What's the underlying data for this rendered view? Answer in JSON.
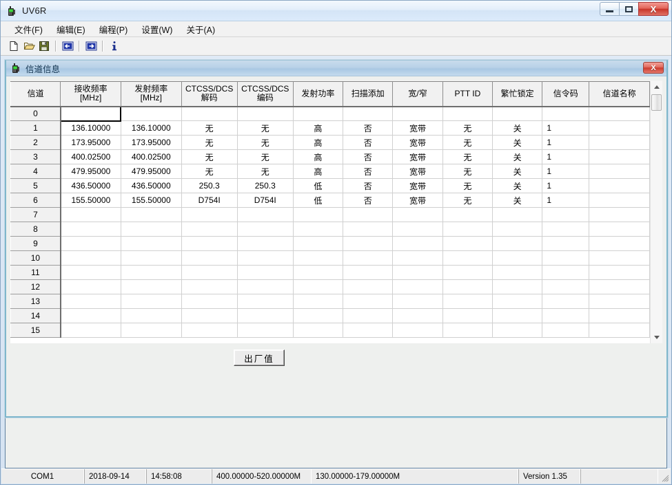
{
  "window": {
    "title": "UV6R",
    "icon": "radio-icon",
    "controls": {
      "minimize": "minimize-icon",
      "maximize": "maximize-icon",
      "close": "X"
    }
  },
  "menubar": {
    "items": [
      {
        "label": "文件(F)",
        "name": "menu-file"
      },
      {
        "label": "编辑(E)",
        "name": "menu-edit"
      },
      {
        "label": "编程(P)",
        "name": "menu-program"
      },
      {
        "label": "设置(W)",
        "name": "menu-settings"
      },
      {
        "label": "关于(A)",
        "name": "menu-about"
      }
    ]
  },
  "toolbar": {
    "buttons": [
      {
        "name": "new-file-icon",
        "title": "新建"
      },
      {
        "name": "open-folder-icon",
        "title": "打开"
      },
      {
        "name": "save-disk-icon",
        "title": "保存"
      },
      {
        "name": "read-from-radio-icon",
        "title": "读取"
      },
      {
        "name": "write-to-radio-icon",
        "title": "写入"
      },
      {
        "name": "info-icon",
        "title": "信息"
      }
    ]
  },
  "child_window": {
    "title": "信道信息",
    "icon": "radio-icon",
    "close_label": "X"
  },
  "grid": {
    "columns": [
      {
        "label": "信道",
        "name": "col-channel"
      },
      {
        "label": "接收频率\n[MHz]",
        "name": "col-rx-freq"
      },
      {
        "label": "发射频率\n[MHz]",
        "name": "col-tx-freq"
      },
      {
        "label": "CTCSS/DCS\n解码",
        "name": "col-ctcss-decode"
      },
      {
        "label": "CTCSS/DCS\n编码",
        "name": "col-ctcss-encode"
      },
      {
        "label": "发射功率",
        "name": "col-tx-power"
      },
      {
        "label": "扫描添加",
        "name": "col-scan-add"
      },
      {
        "label": "宽/窄",
        "name": "col-bandwidth"
      },
      {
        "label": "PTT ID",
        "name": "col-ptt-id"
      },
      {
        "label": "繁忙锁定",
        "name": "col-busy-lock"
      },
      {
        "label": "信令码",
        "name": "col-signal-code"
      },
      {
        "label": "信道名称",
        "name": "col-channel-name"
      }
    ],
    "rows": [
      {
        "channel": "0",
        "rx": "",
        "tx": "",
        "decode": "",
        "encode": "",
        "power": "",
        "scan": "",
        "band": "",
        "ptt": "",
        "busy": "",
        "sigcode": "",
        "name": "",
        "focused_cell": 1
      },
      {
        "channel": "1",
        "rx": "136.10000",
        "tx": "136.10000",
        "decode": "无",
        "encode": "无",
        "power": "高",
        "scan": "否",
        "band": "宽带",
        "ptt": "无",
        "busy": "关",
        "sigcode": "1",
        "name": ""
      },
      {
        "channel": "2",
        "rx": "173.95000",
        "tx": "173.95000",
        "decode": "无",
        "encode": "无",
        "power": "高",
        "scan": "否",
        "band": "宽带",
        "ptt": "无",
        "busy": "关",
        "sigcode": "1",
        "name": ""
      },
      {
        "channel": "3",
        "rx": "400.02500",
        "tx": "400.02500",
        "decode": "无",
        "encode": "无",
        "power": "高",
        "scan": "否",
        "band": "宽带",
        "ptt": "无",
        "busy": "关",
        "sigcode": "1",
        "name": ""
      },
      {
        "channel": "4",
        "rx": "479.95000",
        "tx": "479.95000",
        "decode": "无",
        "encode": "无",
        "power": "高",
        "scan": "否",
        "band": "宽带",
        "ptt": "无",
        "busy": "关",
        "sigcode": "1",
        "name": ""
      },
      {
        "channel": "5",
        "rx": "436.50000",
        "tx": "436.50000",
        "decode": "250.3",
        "encode": "250.3",
        "power": "低",
        "scan": "否",
        "band": "宽带",
        "ptt": "无",
        "busy": "关",
        "sigcode": "1",
        "name": ""
      },
      {
        "channel": "6",
        "rx": "155.50000",
        "tx": "155.50000",
        "decode": "D754I",
        "encode": "D754I",
        "power": "低",
        "scan": "否",
        "band": "宽带",
        "ptt": "无",
        "busy": "关",
        "sigcode": "1",
        "name": ""
      },
      {
        "channel": "7",
        "rx": "",
        "tx": "",
        "decode": "",
        "encode": "",
        "power": "",
        "scan": "",
        "band": "",
        "ptt": "",
        "busy": "",
        "sigcode": "",
        "name": ""
      },
      {
        "channel": "8",
        "rx": "",
        "tx": "",
        "decode": "",
        "encode": "",
        "power": "",
        "scan": "",
        "band": "",
        "ptt": "",
        "busy": "",
        "sigcode": "",
        "name": ""
      },
      {
        "channel": "9",
        "rx": "",
        "tx": "",
        "decode": "",
        "encode": "",
        "power": "",
        "scan": "",
        "band": "",
        "ptt": "",
        "busy": "",
        "sigcode": "",
        "name": ""
      },
      {
        "channel": "10",
        "rx": "",
        "tx": "",
        "decode": "",
        "encode": "",
        "power": "",
        "scan": "",
        "band": "",
        "ptt": "",
        "busy": "",
        "sigcode": "",
        "name": ""
      },
      {
        "channel": "11",
        "rx": "",
        "tx": "",
        "decode": "",
        "encode": "",
        "power": "",
        "scan": "",
        "band": "",
        "ptt": "",
        "busy": "",
        "sigcode": "",
        "name": ""
      },
      {
        "channel": "12",
        "rx": "",
        "tx": "",
        "decode": "",
        "encode": "",
        "power": "",
        "scan": "",
        "band": "",
        "ptt": "",
        "busy": "",
        "sigcode": "",
        "name": ""
      },
      {
        "channel": "13",
        "rx": "",
        "tx": "",
        "decode": "",
        "encode": "",
        "power": "",
        "scan": "",
        "band": "",
        "ptt": "",
        "busy": "",
        "sigcode": "",
        "name": ""
      },
      {
        "channel": "14",
        "rx": "",
        "tx": "",
        "decode": "",
        "encode": "",
        "power": "",
        "scan": "",
        "band": "",
        "ptt": "",
        "busy": "",
        "sigcode": "",
        "name": ""
      },
      {
        "channel": "15",
        "rx": "",
        "tx": "",
        "decode": "",
        "encode": "",
        "power": "",
        "scan": "",
        "band": "",
        "ptt": "",
        "busy": "",
        "sigcode": "",
        "name": ""
      }
    ]
  },
  "actions": {
    "factory_default_label": "出厂值"
  },
  "statusbar": {
    "panes": [
      {
        "text": "COM1",
        "name": "status-com-port"
      },
      {
        "text": "2018-09-14",
        "name": "status-date"
      },
      {
        "text": "14:58:08",
        "name": "status-time"
      },
      {
        "text": "400.00000-520.00000M",
        "name": "status-uhf-range"
      },
      {
        "text": "130.00000-179.00000M",
        "name": "status-vhf-range"
      },
      {
        "text": "",
        "name": "status-spacer"
      },
      {
        "text": "Version 1.35",
        "name": "status-version"
      },
      {
        "text": "",
        "name": "status-end"
      }
    ]
  },
  "colors": {
    "title_gradient_top": "#f3f8fd",
    "child_title": "#b9d2e8",
    "close_red": "#cb3b2e",
    "grid_header": "#f1f1f1",
    "accent_border": "#7fb7cc"
  }
}
